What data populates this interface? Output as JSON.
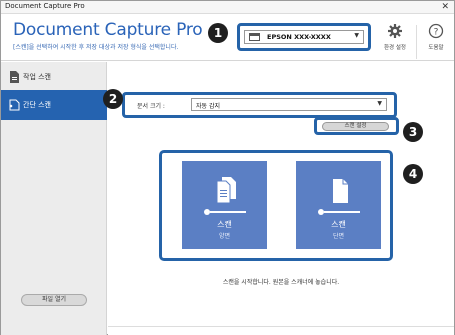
{
  "window": {
    "title": "Document Capture Pro",
    "close_glyph": "✕"
  },
  "header": {
    "app_title": "Document Capture Pro",
    "description": "[스캔]을 선택하여 시작한 후 저장 대상과 저장 형식을 선택합니다.",
    "scanner": {
      "selected": "EPSON XXX-XXXX",
      "icon": "scanner-icon"
    },
    "buttons": [
      {
        "label": "환경 설정",
        "icon": "gear-icon"
      },
      {
        "label": "도움말",
        "icon": "help-icon"
      }
    ]
  },
  "sidebar": {
    "items": [
      {
        "label": "작업 스캔",
        "icon": "job-scan-icon",
        "active": false
      },
      {
        "label": "간단 스캔",
        "icon": "simple-scan-icon",
        "active": true
      }
    ],
    "open_file_label": "파일 열기"
  },
  "main": {
    "document_size_label": "문서 크기 :",
    "document_size_value": "자동 감지",
    "scan_settings_label": "스캔 설정",
    "tiles": [
      {
        "title": "스캔",
        "subtitle": "양면"
      },
      {
        "title": "스캔",
        "subtitle": "단면"
      }
    ],
    "status": "스캔을 시작합니다. 원본을 스캐너에 놓습니다."
  },
  "callouts": [
    "1",
    "2",
    "3",
    "4"
  ],
  "colors": {
    "accent": "#2563a8",
    "tile": "#5b7fc4",
    "sidebar_active": "#2563b0"
  }
}
